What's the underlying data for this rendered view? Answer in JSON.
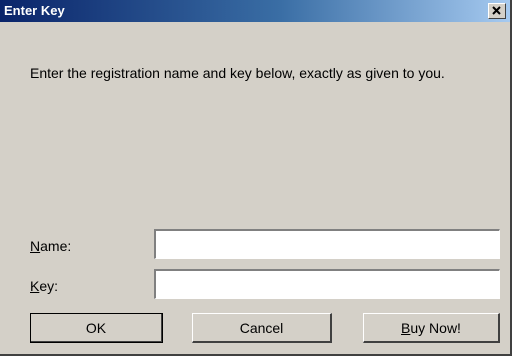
{
  "window": {
    "title": "Enter Key",
    "close_glyph": "×"
  },
  "message": "Enter the registration name and key below, exactly as given to you.",
  "fields": {
    "name": {
      "label_mnemonic": "N",
      "label_rest": "ame:",
      "value": ""
    },
    "key": {
      "label_mnemonic": "K",
      "label_rest": "ey:",
      "value": ""
    }
  },
  "buttons": {
    "ok": {
      "label": "OK"
    },
    "cancel": {
      "label": "Cancel"
    },
    "buy_now": {
      "label_mnemonic": "B",
      "label_rest": "uy Now!"
    }
  },
  "colors": {
    "title_gradient_start": "#0a246a",
    "title_gradient_end": "#a6caf0",
    "dialog_face": "#d4d0c8"
  }
}
